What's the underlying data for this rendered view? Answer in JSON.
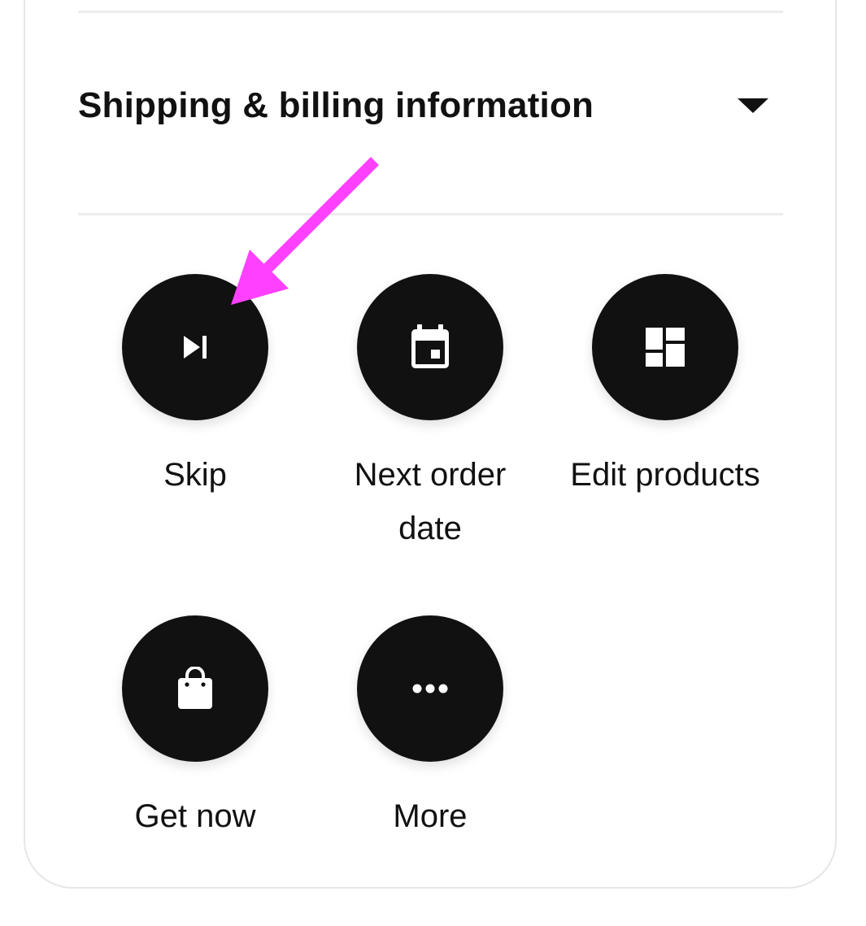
{
  "section": {
    "title": "Shipping & billing information",
    "toggle_icon": "caret-down-icon"
  },
  "actions": [
    {
      "label": "Skip",
      "icon": "skip-next-icon"
    },
    {
      "label": "Next order date",
      "icon": "calendar-icon"
    },
    {
      "label": "Edit products",
      "icon": "dashboard-icon"
    },
    {
      "label": "Get now",
      "icon": "shopping-bag-icon"
    },
    {
      "label": "More",
      "icon": "more-horizontal-icon"
    }
  ],
  "colors": {
    "button_bg": "#111111",
    "icon_fg": "#ffffff",
    "annotation_arrow": "#ff40ff",
    "divider": "#ececec",
    "card_border": "#e6e6e6"
  }
}
